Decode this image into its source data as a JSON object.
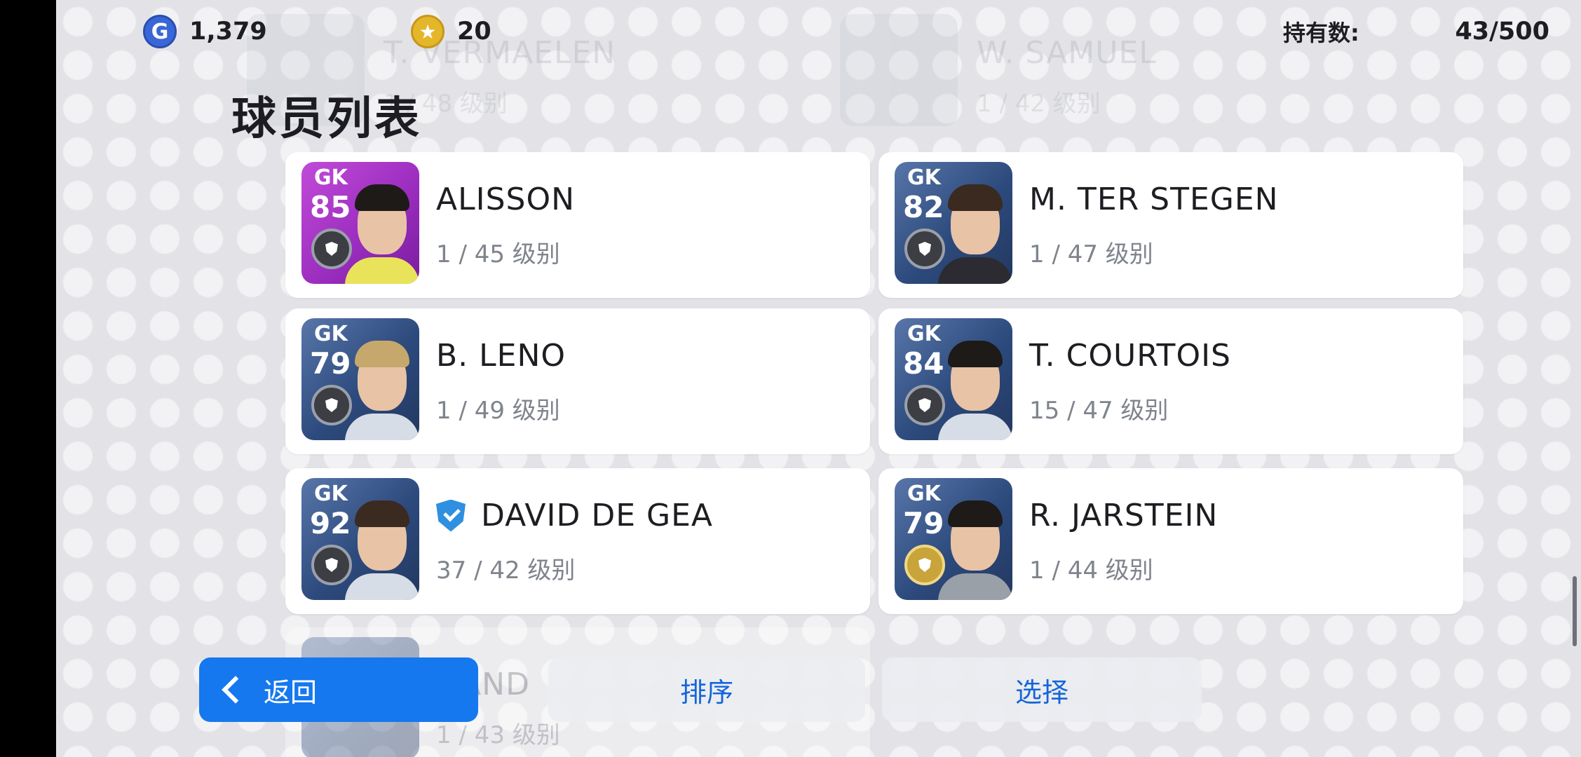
{
  "header": {
    "gp_amount": "1,379",
    "coin_amount": "20",
    "owned_label": "持有数:",
    "owned_value": "43/500"
  },
  "page_title": "球员列表",
  "background_rows": [
    {
      "name": "T. VERMAELEN",
      "sub": "1 / 48 级别"
    },
    {
      "name": "W. SAMUEL",
      "sub": "1 / 42 级别"
    }
  ],
  "players": [
    {
      "position": "GK",
      "rating": "85",
      "name": "ALISSON",
      "level": "1 / 45 级别",
      "card": "featured",
      "badge": "silver"
    },
    {
      "position": "GK",
      "rating": "82",
      "name": "M. TER STEGEN",
      "level": "1 / 47 级别",
      "card": "standard",
      "badge": "silver"
    },
    {
      "position": "GK",
      "rating": "79",
      "name": "B. LENO",
      "level": "1 / 49 级别",
      "card": "standard",
      "badge": "silver"
    },
    {
      "position": "GK",
      "rating": "84",
      "name": "T. COURTOIS",
      "level": "15 / 47 级别",
      "card": "standard",
      "badge": "silver"
    },
    {
      "position": "GK",
      "rating": "92",
      "name": "DAVID DE GEA",
      "level": "37 / 42 级别",
      "card": "standard",
      "badge": "silver",
      "verified": true
    },
    {
      "position": "GK",
      "rating": "79",
      "name": "R. JARSTEIN",
      "level": "1 / 44 级别",
      "card": "standard",
      "badge": "gold"
    }
  ],
  "partial_row": {
    "name": "HAND",
    "level": "1 / 43 级别"
  },
  "bottom_bar": {
    "back_label": "返回",
    "sort_label": "排序",
    "select_label": "选择"
  },
  "colors": {
    "accent": "#1578ee",
    "featured_card": "#9c2ec0",
    "standard_card": "#2d4a7d",
    "verified": "#2f8fe0"
  }
}
